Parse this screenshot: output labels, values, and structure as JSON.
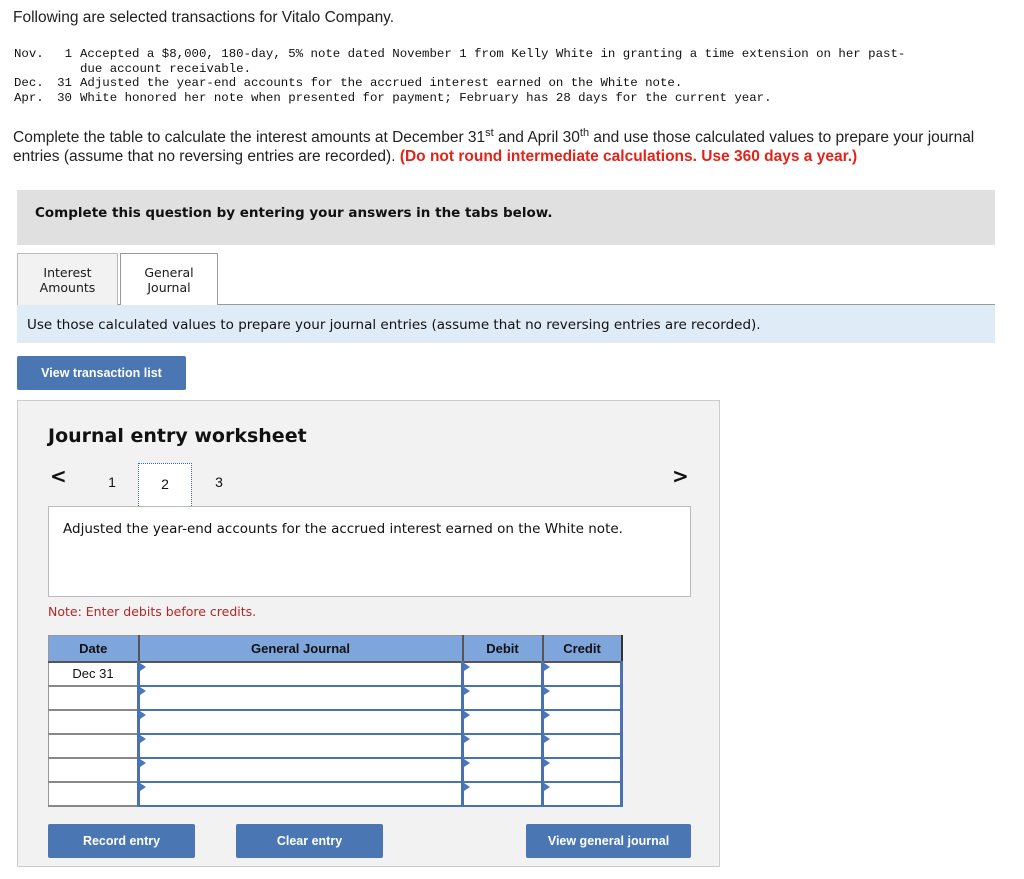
{
  "intro": "Following are selected transactions for Vitalo Company.",
  "transactions": [
    {
      "month": "Nov.",
      "day": "1",
      "description": "Accepted a $8,000, 180-day, 5% note dated November 1 from Kelly White in granting a time extension on her past-",
      "continuation": "due account receivable."
    },
    {
      "month": "Dec.",
      "day": "31",
      "description": "Adjusted the year-end accounts for the accrued interest earned on the White note."
    },
    {
      "month": "Apr.",
      "day": "30",
      "description": "White honored her note when presented for payment; February has 28 days for the current year."
    }
  ],
  "instructions": {
    "part1": "Complete the table to calculate the interest amounts at December 31",
    "sup1": "st",
    "part2": " and April 30",
    "sup2": "th",
    "part3": " and use those calculated values to prepare your journal entries (assume that no reversing entries are recorded). ",
    "warning": "(Do not round intermediate calculations. Use 360 days a year.)",
    "warning_color": "#e2231a"
  },
  "banner": "Complete this question by entering your answers in the tabs below.",
  "tabs": [
    {
      "line1": "Interest",
      "line2": "Amounts",
      "active": false
    },
    {
      "line1": "General",
      "line2": "Journal",
      "active": true
    }
  ],
  "tab_instruction": "Use those calculated values to prepare your journal entries (assume that no reversing entries are recorded).",
  "view_transaction_list_label": "View transaction list",
  "worksheet": {
    "title": "Journal entry worksheet",
    "pager": {
      "prev": "<",
      "next": ">",
      "pages": [
        "1",
        "2",
        "3"
      ],
      "current": "2"
    },
    "description": "Adjusted the year-end accounts for the accrued interest earned on the White note.",
    "note": "Note: Enter debits before credits.",
    "table": {
      "headers": {
        "date": "Date",
        "general_journal": "General Journal",
        "debit": "Debit",
        "credit": "Credit"
      },
      "rows": [
        {
          "date": "Dec 31",
          "account": "",
          "debit": "",
          "credit": ""
        },
        {
          "date": "",
          "account": "",
          "debit": "",
          "credit": ""
        },
        {
          "date": "",
          "account": "",
          "debit": "",
          "credit": ""
        },
        {
          "date": "",
          "account": "",
          "debit": "",
          "credit": ""
        },
        {
          "date": "",
          "account": "",
          "debit": "",
          "credit": ""
        },
        {
          "date": "",
          "account": "",
          "debit": "",
          "credit": ""
        }
      ]
    },
    "buttons": {
      "record": "Record entry",
      "clear": "Clear entry",
      "view_general_journal": "View general journal"
    }
  },
  "colors": {
    "button_blue": "#4a77b4",
    "header_blue": "#7ea6dc",
    "note_red": "#b32727",
    "subinstr_bg": "#dfebf7"
  }
}
